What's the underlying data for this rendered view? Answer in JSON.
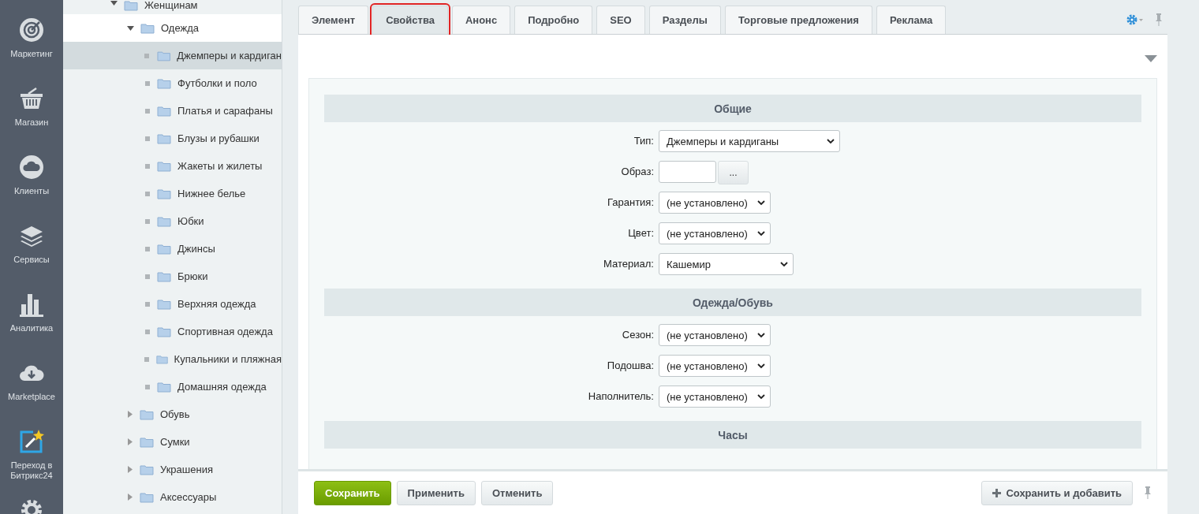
{
  "rail": [
    {
      "kind": "target",
      "label": "Маркетинг"
    },
    {
      "kind": "basket",
      "label": "Магазин"
    },
    {
      "kind": "cloud24",
      "label": "Клиенты"
    },
    {
      "kind": "layers",
      "label": "Сервисы"
    },
    {
      "kind": "chart",
      "label": "Аналитика"
    },
    {
      "kind": "download",
      "label": "Marketplace"
    },
    {
      "kind": "magic",
      "label": "Переход в Битрикс24"
    },
    {
      "kind": "gear"
    }
  ],
  "tree": [
    {
      "label": "Женщинам",
      "expanded": true,
      "selected": false,
      "children": [
        {
          "label": "Одежда",
          "expanded": true,
          "selected": false,
          "hovered": true,
          "children": [
            {
              "label": "Джемперы и кардиган",
              "selected": true
            },
            {
              "label": "Футболки и поло",
              "selected": false
            },
            {
              "label": "Платья и сарафаны",
              "selected": false
            },
            {
              "label": "Блузы и рубашки",
              "selected": false
            },
            {
              "label": "Жакеты и жилеты",
              "selected": false
            },
            {
              "label": "Нижнее белье",
              "selected": false
            },
            {
              "label": "Юбки",
              "selected": false
            },
            {
              "label": "Джинсы",
              "selected": false
            },
            {
              "label": "Брюки",
              "selected": false
            },
            {
              "label": "Верхняя одежда",
              "selected": false
            },
            {
              "label": "Спортивная одежда",
              "selected": false
            },
            {
              "label": "Купальники и пляжная",
              "selected": false
            },
            {
              "label": "Домашняя одежда",
              "selected": false
            }
          ]
        },
        {
          "label": "Обувь",
          "expanded": false,
          "selected": false
        },
        {
          "label": "Сумки",
          "expanded": false,
          "selected": false
        },
        {
          "label": "Украшения",
          "expanded": false,
          "selected": false
        },
        {
          "label": "Аксессуары",
          "expanded": false,
          "selected": false
        }
      ]
    }
  ],
  "tabs": [
    {
      "label": "Элемент",
      "selected": false,
      "outlined": false
    },
    {
      "label": "Свойства",
      "selected": true,
      "outlined": true
    },
    {
      "label": "Анонс",
      "selected": false,
      "outlined": false
    },
    {
      "label": "Подробно",
      "selected": false,
      "outlined": false
    },
    {
      "label": "SEO",
      "selected": false,
      "outlined": false
    },
    {
      "label": "Разделы",
      "selected": false,
      "outlined": false
    },
    {
      "label": "Торговые предложения",
      "selected": false,
      "outlined": false
    },
    {
      "label": "Реклама",
      "selected": false,
      "outlined": false
    }
  ],
  "sections": [
    {
      "title": "Общие",
      "fields": [
        {
          "kind": "select",
          "label": "Тип:",
          "value": "Джемперы и кардиганы"
        },
        {
          "kind": "file",
          "label": "Образ:",
          "button": "..."
        },
        {
          "kind": "select",
          "label": "Гарантия:",
          "value": "(не установлено)"
        },
        {
          "kind": "select",
          "label": "Цвет:",
          "value": "(не установлено)"
        },
        {
          "kind": "select",
          "label": "Материал:",
          "value": "Кашемир"
        }
      ]
    },
    {
      "title": "Одежда/Обувь",
      "fields": [
        {
          "kind": "select",
          "label": "Сезон:",
          "value": "(не установлено)"
        },
        {
          "kind": "select",
          "label": "Подошва:",
          "value": "(не установлено)"
        },
        {
          "kind": "select",
          "label": "Наполнитель:",
          "value": "(не установлено)"
        }
      ]
    },
    {
      "title": "Часы"
    }
  ],
  "footer": {
    "buttons": [
      {
        "kind": "primary",
        "label": "Сохранить"
      },
      {
        "kind": "plain",
        "label": "Применить"
      },
      {
        "kind": "plain",
        "label": "Отменить"
      }
    ],
    "add_button": {
      "label": "Сохранить и добавить"
    }
  }
}
